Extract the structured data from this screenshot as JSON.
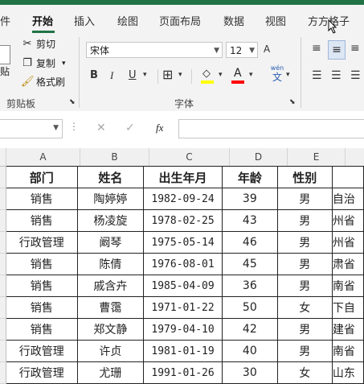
{
  "tabs": [
    {
      "label": "件",
      "active": false
    },
    {
      "label": "开始",
      "active": true
    },
    {
      "label": "插入",
      "active": false
    },
    {
      "label": "绘图",
      "active": false
    },
    {
      "label": "页面布局",
      "active": false
    },
    {
      "label": "数据",
      "active": false
    },
    {
      "label": "视图",
      "active": false
    },
    {
      "label": "方方格子",
      "active": false
    }
  ],
  "ribbon": {
    "clipboard": {
      "paste_label": "贴",
      "cut": "剪切",
      "copy": "复制",
      "format_painter": "格式刷",
      "group_label": "剪贴板"
    },
    "font": {
      "font_name": "宋体",
      "font_size": "12",
      "bold": "B",
      "italic": "I",
      "underline": "U",
      "phonetic_top": "wén",
      "phonetic_bottom": "文",
      "group_label": "字体"
    }
  },
  "formula_bar": {
    "name_box": "",
    "fx_label": "fx",
    "formula": ""
  },
  "columns": [
    "A",
    "B",
    "C",
    "D",
    "E"
  ],
  "table": {
    "headers": [
      "部门",
      "姓名",
      "出生年月",
      "年龄",
      "性别"
    ],
    "rows": [
      [
        "销售",
        "陶婷婷",
        "1982-09-24",
        "39",
        "男",
        "自治"
      ],
      [
        "销售",
        "杨凌旋",
        "1978-02-25",
        "43",
        "男",
        "州省"
      ],
      [
        "行政管理",
        "阚琴",
        "1975-05-14",
        "46",
        "男",
        "州省"
      ],
      [
        "销售",
        "陈倩",
        "1976-08-01",
        "45",
        "男",
        "肃省"
      ],
      [
        "销售",
        "戚含卉",
        "1985-04-09",
        "36",
        "男",
        "南省"
      ],
      [
        "销售",
        "曹霭",
        "1971-01-22",
        "50",
        "女",
        "下自"
      ],
      [
        "销售",
        "郑文静",
        "1979-04-10",
        "42",
        "男",
        "建省"
      ],
      [
        "行政管理",
        "许贞",
        "1981-01-19",
        "40",
        "男",
        "南省"
      ],
      [
        "行政管理",
        "尤珊",
        "1991-01-26",
        "30",
        "女",
        "山东"
      ]
    ]
  },
  "colors": {
    "accent": "#217346",
    "font_highlight": "#ffff00",
    "font_color": "#ff0000"
  }
}
